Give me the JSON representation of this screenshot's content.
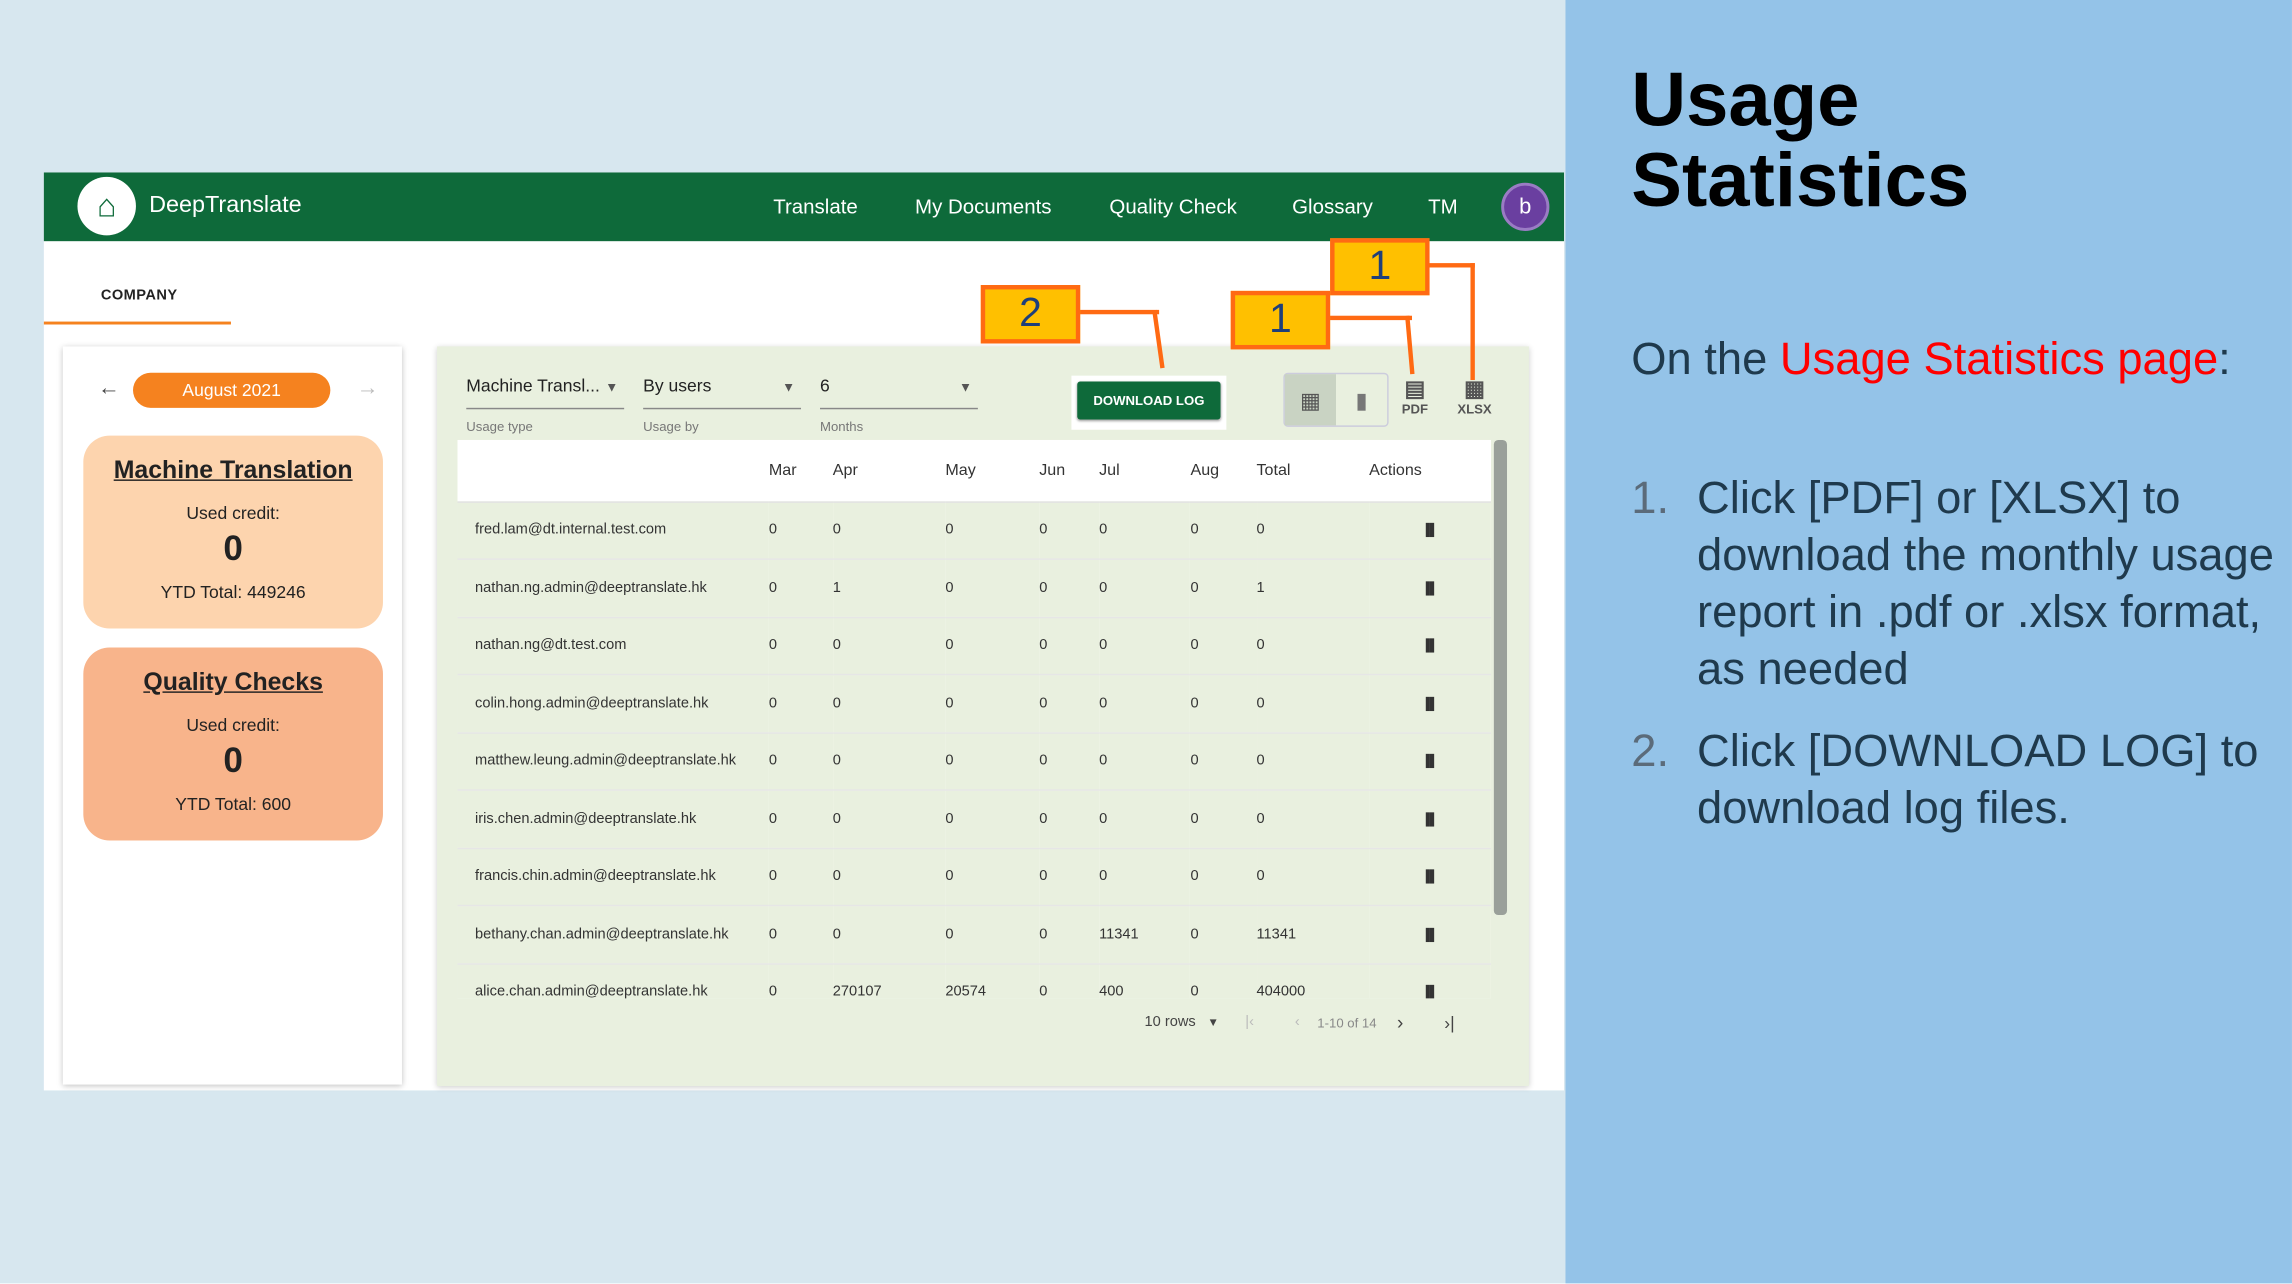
{
  "header": {
    "brand": "DeepTranslate",
    "nav": [
      "Translate",
      "My Documents",
      "Quality Check",
      "Glossary",
      "TM"
    ],
    "avatar": "b"
  },
  "tabs": [
    "COMPANY"
  ],
  "month": {
    "label": "August 2021"
  },
  "credits": [
    {
      "title": "Machine Translation",
      "used_label": "Used credit:",
      "used": "0",
      "ytd": "YTD Total: 449246"
    },
    {
      "title": "Quality Checks",
      "used_label": "Used credit:",
      "used": "0",
      "ytd": "YTD Total: 600"
    }
  ],
  "filters": [
    {
      "value": "Machine Transl...",
      "caption": "Usage type"
    },
    {
      "value": "By users",
      "caption": "Usage by"
    },
    {
      "value": "6",
      "caption": "Months"
    }
  ],
  "download_log": "DOWNLOAD LOG",
  "export": {
    "pdf": "PDF",
    "xlsx": "XLSX"
  },
  "table": {
    "columns": [
      "",
      "Mar",
      "Apr",
      "May",
      "Jun",
      "Jul",
      "Aug",
      "Total",
      "Actions"
    ],
    "rows": [
      [
        "fred.lam@dt.internal.test.com",
        "0",
        "0",
        "0",
        "0",
        "0",
        "0",
        "0"
      ],
      [
        "nathan.ng.admin@deeptranslate.hk",
        "0",
        "1",
        "0",
        "0",
        "0",
        "0",
        "1"
      ],
      [
        "nathan.ng@dt.test.com",
        "0",
        "0",
        "0",
        "0",
        "0",
        "0",
        "0"
      ],
      [
        "colin.hong.admin@deeptranslate.hk",
        "0",
        "0",
        "0",
        "0",
        "0",
        "0",
        "0"
      ],
      [
        "matthew.leung.admin@deeptranslate.hk",
        "0",
        "0",
        "0",
        "0",
        "0",
        "0",
        "0"
      ],
      [
        "iris.chen.admin@deeptranslate.hk",
        "0",
        "0",
        "0",
        "0",
        "0",
        "0",
        "0"
      ],
      [
        "francis.chin.admin@deeptranslate.hk",
        "0",
        "0",
        "0",
        "0",
        "0",
        "0",
        "0"
      ],
      [
        "bethany.chan.admin@deeptranslate.hk",
        "0",
        "0",
        "0",
        "0",
        "11341",
        "0",
        "11341"
      ],
      [
        "alice.chan.admin@deeptranslate.hk",
        "0",
        "270107",
        "20574",
        "0",
        "400",
        "0",
        "404000"
      ]
    ]
  },
  "pager": {
    "rows": "10 rows",
    "range": "1-10 of 14"
  },
  "callouts": [
    "2",
    "1",
    "1"
  ],
  "slide": {
    "title": "Usage Statistics",
    "intro_pre": "On the ",
    "intro_hl": "Usage Statistics page",
    "intro_post": ":",
    "steps": [
      {
        "n": "1.",
        "text": "Click [PDF] or [XLSX] to download the monthly usage report in .pdf or .xlsx format, as needed"
      },
      {
        "n": "2.",
        "text": "Click [DOWNLOAD LOG] to download log files."
      }
    ],
    "highlight_color": "#ff0000"
  }
}
